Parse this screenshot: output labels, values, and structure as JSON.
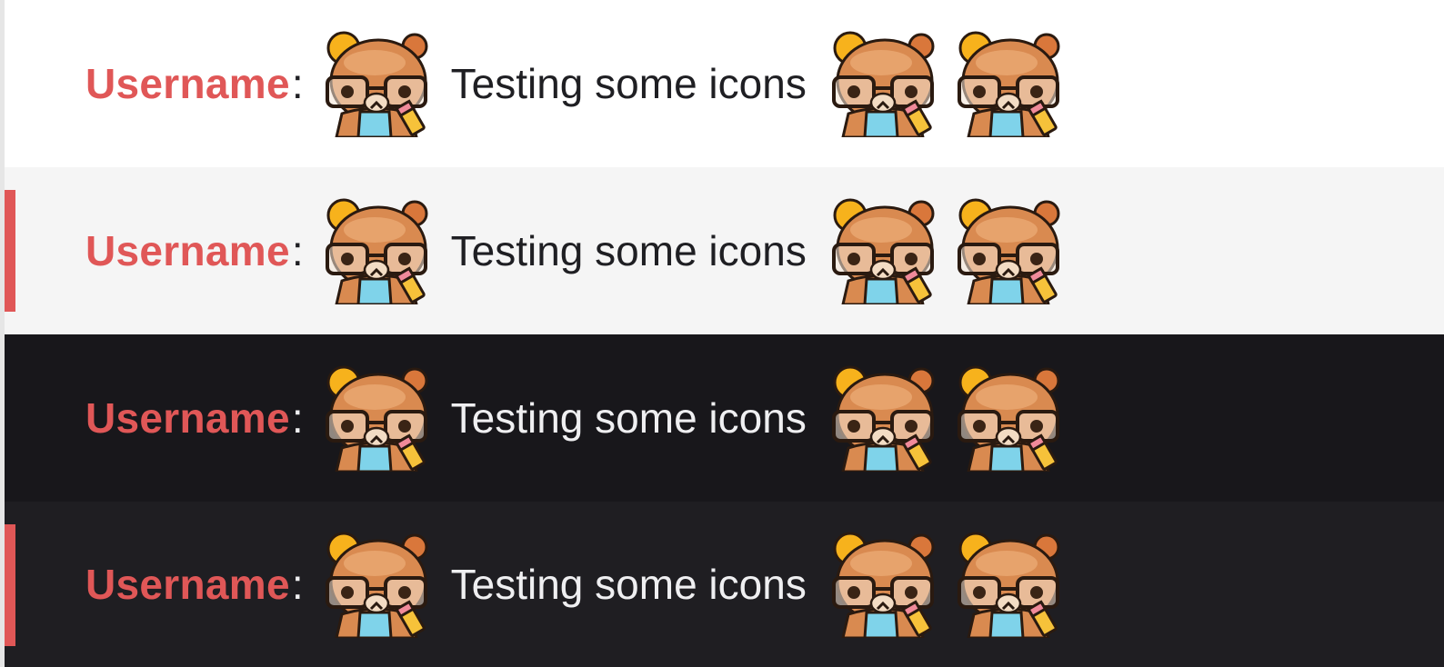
{
  "colors": {
    "username": "#e05757",
    "highlight_bar": "#e05757",
    "light_row": "#ffffff",
    "light_row_alt": "#f5f5f5",
    "dark_row": "#18171b",
    "dark_row_alt": "#1f1e22",
    "light_text": "#1f1f23",
    "dark_text": "#efeff1"
  },
  "messages": [
    {
      "theme": "light",
      "highlighted": false,
      "username": "Username",
      "separator": ":",
      "text": "Testing some icons",
      "emote": "bear-emote-icon"
    },
    {
      "theme": "light",
      "highlighted": true,
      "username": "Username",
      "separator": ":",
      "text": "Testing some icons",
      "emote": "bear-emote-icon"
    },
    {
      "theme": "dark",
      "highlighted": false,
      "username": "Username",
      "separator": ":",
      "text": "Testing some icons",
      "emote": "bear-emote-icon"
    },
    {
      "theme": "dark",
      "highlighted": true,
      "username": "Username",
      "separator": ":",
      "text": "Testing some icons",
      "emote": "bear-emote-icon"
    }
  ]
}
